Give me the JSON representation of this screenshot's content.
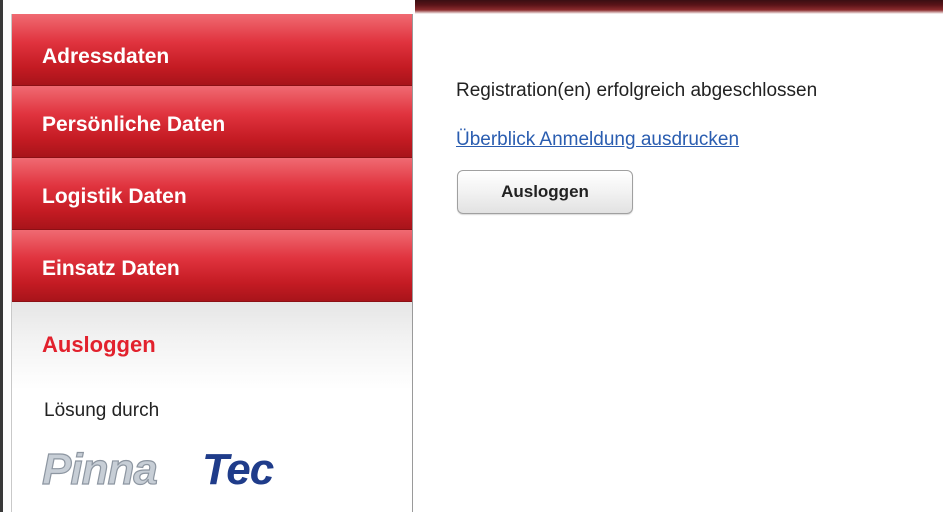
{
  "sidebar": {
    "items": [
      {
        "label": "Adressdaten"
      },
      {
        "label": "Persönliche Daten"
      },
      {
        "label": "Logistik Daten"
      },
      {
        "label": "Einsatz Daten"
      }
    ],
    "logout_label": "Ausloggen",
    "solution_by": "Lösung durch",
    "logo": {
      "text_part1": "Pinna",
      "text_part2": "Tec"
    }
  },
  "main": {
    "status_text": "Registration(en) erfolgreich abgeschlossen",
    "print_link": "Überblick Anmeldung ausdrucken",
    "logout_button": "Ausloggen"
  },
  "colors": {
    "nav_red": "#d32a33",
    "logout_text": "#e2212d",
    "link_blue": "#2a5db0",
    "logo_grey": "#9aa4b0",
    "logo_navy": "#1f3c8a"
  }
}
